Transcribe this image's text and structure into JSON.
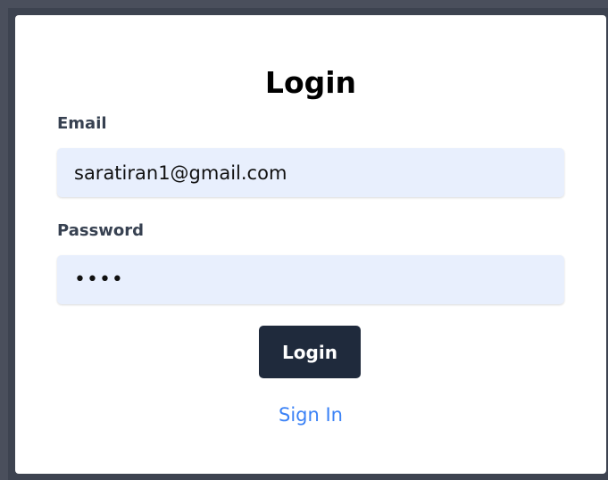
{
  "login_form": {
    "title": "Login",
    "email": {
      "label": "Email",
      "value": "saratiran1@gmail.com"
    },
    "password": {
      "label": "Password",
      "value": "••••"
    },
    "submit_label": "Login",
    "signin_link": "Sign In"
  },
  "colors": {
    "backdrop": "#4a4f5c",
    "card": "#ffffff",
    "input_bg": "#e8effd",
    "button_bg": "#1f2a3c",
    "link": "#3b82f6",
    "label": "#374151"
  }
}
